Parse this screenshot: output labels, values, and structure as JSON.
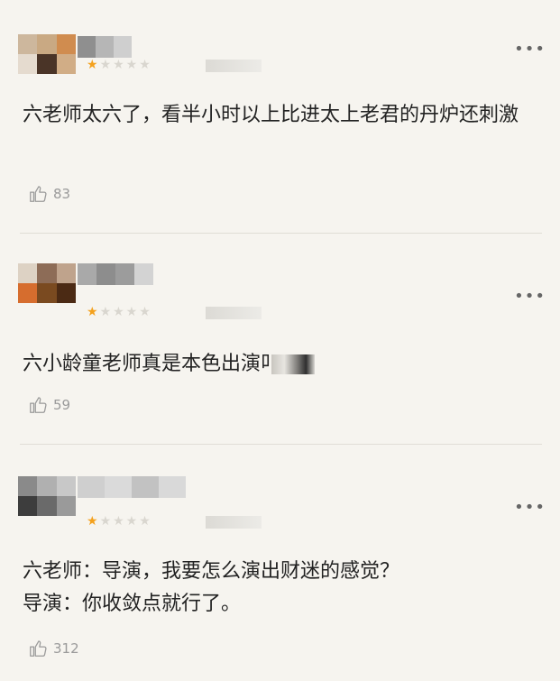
{
  "colors": {
    "background": "#f6f4ef",
    "star_filled": "#f4a11d",
    "star_empty": "#d9d6cf",
    "text": "#222222",
    "muted": "#9a9a9a"
  },
  "comments": [
    {
      "rating": 1,
      "max_rating": 5,
      "content": "六老师太六了，看半小时以上比进太上老君的丹炉还刺激",
      "likes": "83",
      "icon": "thumbs-up-icon",
      "more_icon": "more-dots-icon"
    },
    {
      "rating": 1,
      "max_rating": 5,
      "content": "六小龄童老师真是本色出演",
      "content_tail": "叫",
      "likes": "59",
      "icon": "thumbs-up-icon",
      "more_icon": "more-dots-icon"
    },
    {
      "rating": 1,
      "max_rating": 5,
      "content_line1": "六老师：导演，我要怎么演出财迷的感觉？",
      "content_line2": "导演：你收敛点就行了。",
      "likes": "312",
      "icon": "thumbs-up-icon",
      "more_icon": "more-dots-icon"
    }
  ]
}
